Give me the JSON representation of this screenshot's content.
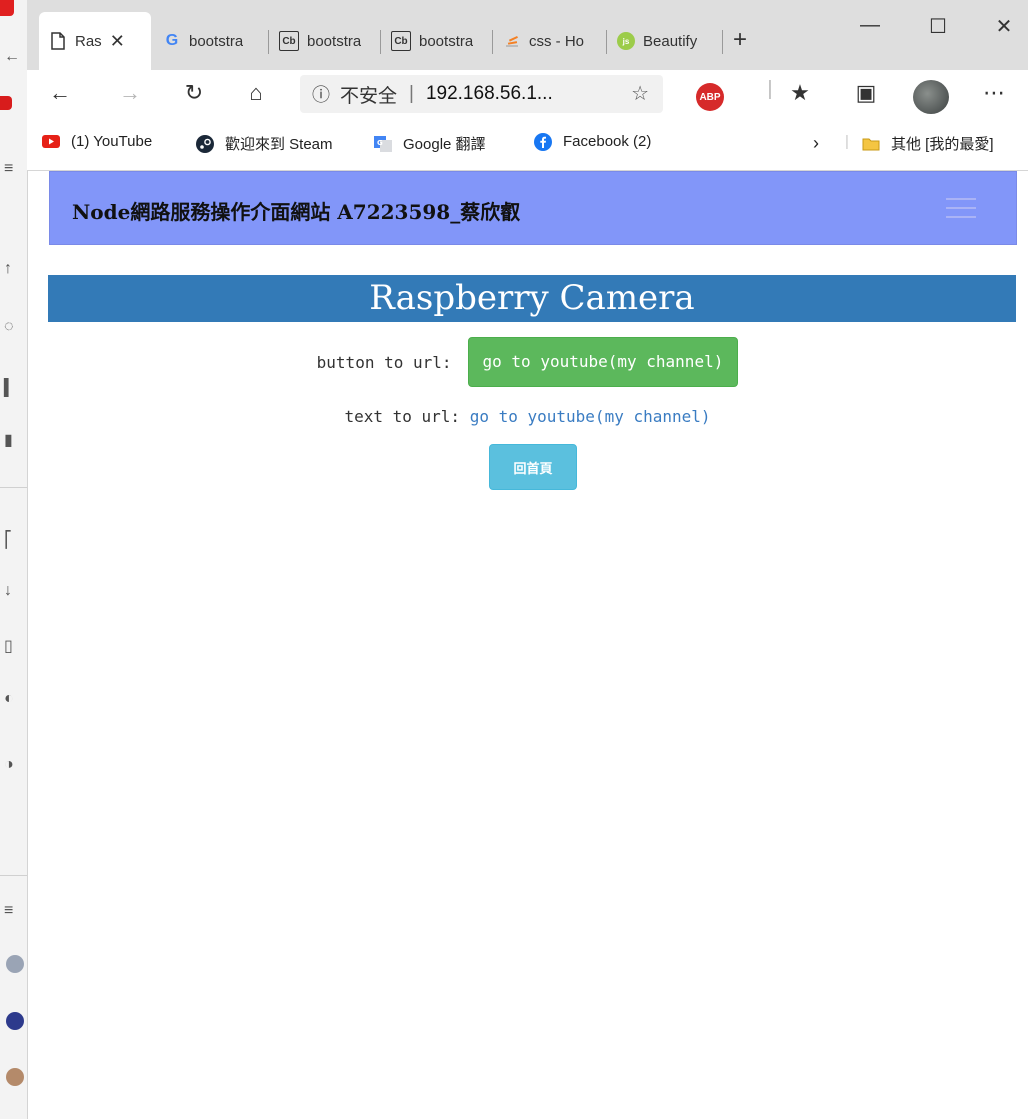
{
  "tabs": [
    {
      "label": "Ras",
      "icon": "page-icon",
      "active": true
    },
    {
      "label": "bootstra",
      "icon": "google-icon"
    },
    {
      "label": "bootstra",
      "icon": "codeply-icon",
      "icon_text": "Cb"
    },
    {
      "label": "bootstra",
      "icon": "codeply-icon",
      "icon_text": "Cb"
    },
    {
      "label": "css - Ho",
      "icon": "stackoverflow-icon"
    },
    {
      "label": "Beautify",
      "icon": "beautify-icon"
    }
  ],
  "address": {
    "security_label": "不安全",
    "separator": "|",
    "url": "192.168.56.1..."
  },
  "extensions": {
    "abp_label": "ABP"
  },
  "bookmarks": [
    {
      "label": "(1) YouTube",
      "icon": "youtube-icon"
    },
    {
      "label": "歡迎來到 Steam",
      "icon": "steam-icon"
    },
    {
      "label": "Google 翻譯",
      "icon": "google-translate-icon"
    },
    {
      "label": "Facebook (2)",
      "icon": "facebook-icon"
    }
  ],
  "other_bookmarks": "其他 [我的最愛]",
  "navbar": {
    "brand": "Node網路服務操作介面網站 A7223598_蔡欣叡"
  },
  "jumbotron": {
    "title": "Raspberry Camera"
  },
  "content": {
    "button_prefix": "button to url:",
    "button_label": "go to youtube(my channel)",
    "text_prefix": "text to url:",
    "link_label": "go to youtube(my channel)",
    "home_button": "回首頁"
  },
  "colors": {
    "navbar_bg": "#8296f9",
    "jumbotron_bg": "#337ab7",
    "button_success": "#5cb85c",
    "button_info": "#5bc0de",
    "link": "#3a7cc2"
  }
}
